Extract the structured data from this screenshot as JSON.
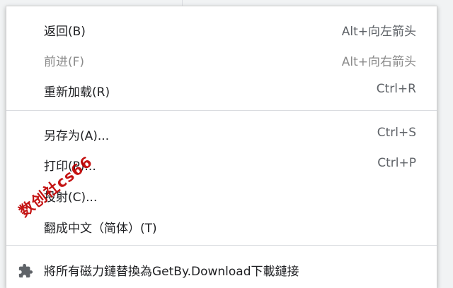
{
  "menu": {
    "items": [
      {
        "label": "返回(B)",
        "shortcut": "Alt+向左箭头"
      },
      {
        "label": "前进(F)",
        "shortcut": "Alt+向右箭头"
      },
      {
        "label": "重新加载(R)",
        "shortcut": "Ctrl+R"
      },
      {
        "label": "另存为(A)...",
        "shortcut": "Ctrl+S"
      },
      {
        "label": "打印(P)...",
        "shortcut": "Ctrl+P"
      },
      {
        "label": "投射(C)..."
      },
      {
        "label": "翻成中文（简体）(T)"
      },
      {
        "label": "將所有磁力鏈替換為GetBy.Download下載鏈接",
        "icon": "puzzle-icon"
      }
    ]
  },
  "watermark": {
    "text": "数创社cs66"
  },
  "colors": {
    "menu_bg": "#ffffff",
    "page_bg": "#f1f3f4",
    "text": "#202124",
    "disabled_text": "#8a8a8a",
    "watermark": "#c00000"
  }
}
